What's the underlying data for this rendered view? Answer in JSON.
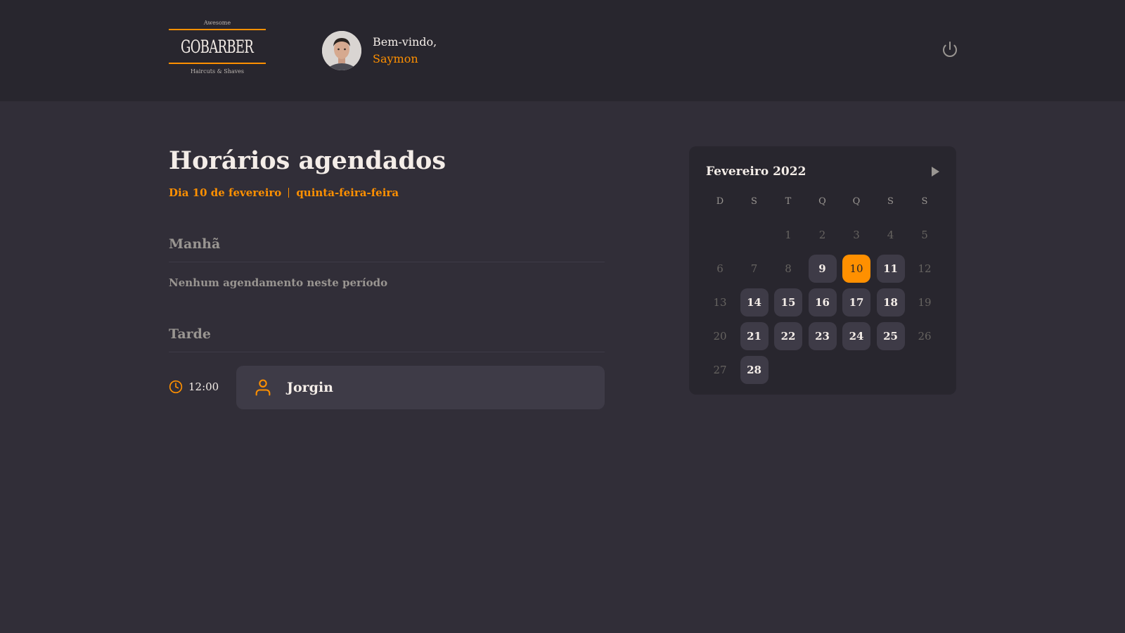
{
  "brand": {
    "top_text": "Awesome",
    "name": "GOBARBER",
    "subtitle": "Haircuts & Shaves",
    "accent_color": "#ff9000"
  },
  "header": {
    "greeting": "Bem-vindo,",
    "user_name": "Saymon",
    "logout_icon": "power-icon"
  },
  "main": {
    "title": "Horários agendados",
    "date_label": "Dia 10 de fevereiro",
    "weekday_label": "quinta-feira-feira",
    "morning": {
      "title": "Manhã",
      "empty_message": "Nenhum agendamento neste período"
    },
    "afternoon": {
      "title": "Tarde",
      "appointments": [
        {
          "time": "12:00",
          "client": "Jorgin",
          "time_icon": "clock-icon",
          "client_icon": "user-icon"
        }
      ]
    }
  },
  "calendar": {
    "month_label": "Fevereiro 2022",
    "next_icon": "play-icon",
    "weekdays": [
      "D",
      "S",
      "T",
      "Q",
      "Q",
      "S",
      "S"
    ],
    "leading_blanks": 2,
    "days": [
      {
        "d": "1",
        "state": "disabled"
      },
      {
        "d": "2",
        "state": "disabled"
      },
      {
        "d": "3",
        "state": "disabled"
      },
      {
        "d": "4",
        "state": "disabled"
      },
      {
        "d": "5",
        "state": "disabled"
      },
      {
        "d": "6",
        "state": "disabled"
      },
      {
        "d": "7",
        "state": "disabled"
      },
      {
        "d": "8",
        "state": "disabled"
      },
      {
        "d": "9",
        "state": "available"
      },
      {
        "d": "10",
        "state": "selected"
      },
      {
        "d": "11",
        "state": "available"
      },
      {
        "d": "12",
        "state": "disabled"
      },
      {
        "d": "13",
        "state": "disabled"
      },
      {
        "d": "14",
        "state": "available"
      },
      {
        "d": "15",
        "state": "available"
      },
      {
        "d": "16",
        "state": "available"
      },
      {
        "d": "17",
        "state": "available"
      },
      {
        "d": "18",
        "state": "available"
      },
      {
        "d": "19",
        "state": "disabled"
      },
      {
        "d": "20",
        "state": "disabled"
      },
      {
        "d": "21",
        "state": "available"
      },
      {
        "d": "22",
        "state": "available"
      },
      {
        "d": "23",
        "state": "available"
      },
      {
        "d": "24",
        "state": "available"
      },
      {
        "d": "25",
        "state": "available"
      },
      {
        "d": "26",
        "state": "disabled"
      },
      {
        "d": "27",
        "state": "disabled"
      },
      {
        "d": "28",
        "state": "available"
      }
    ]
  }
}
